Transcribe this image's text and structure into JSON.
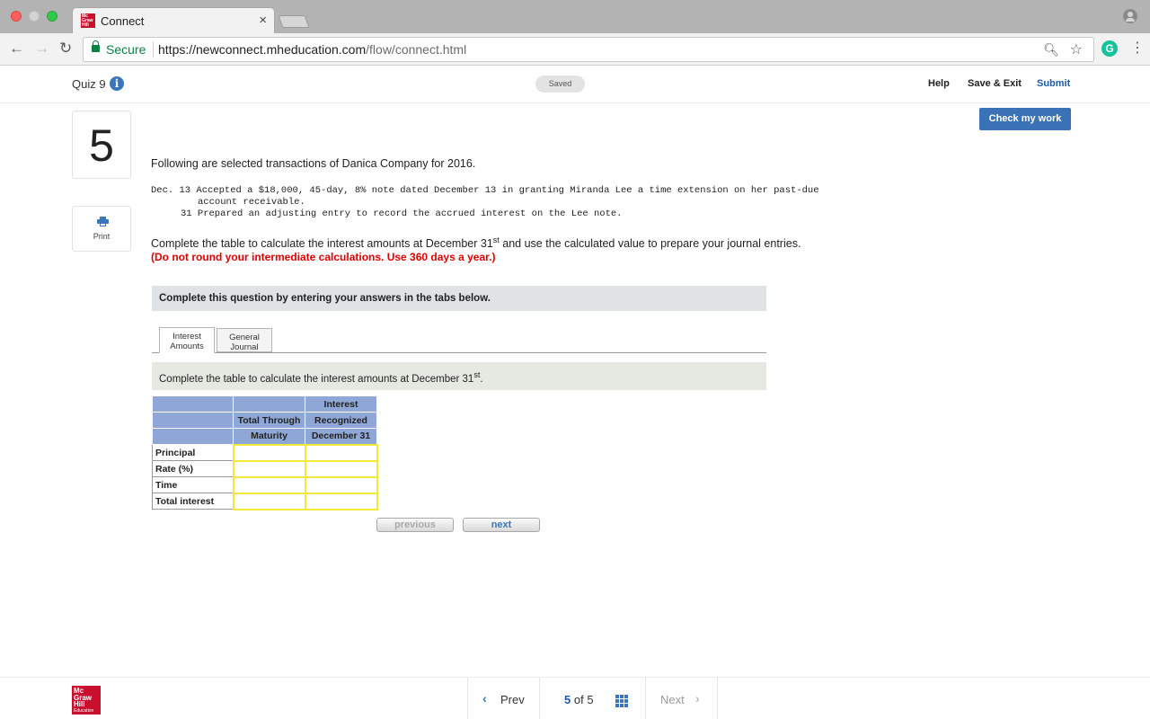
{
  "browser": {
    "tab_title": "Connect",
    "tab_close": "×",
    "secure_label": "Secure",
    "url_host": "https://newconnect.mheducation.com",
    "url_path": "/flow/connect.html"
  },
  "header": {
    "quiz_title": "Quiz 9",
    "info": "i",
    "saved": "Saved",
    "help": "Help",
    "save_exit": "Save & Exit",
    "submit": "Submit"
  },
  "question": {
    "number": "5",
    "print_label": "Print",
    "check_my_work": "Check my work",
    "intro": "Following are selected transactions of Danica Company for 2016.",
    "transactions": [
      "Dec. 13 Accepted a $18,000, 45-day, 8% note dated December 13 in granting Miranda Lee a time extension on her past-due",
      "account receivable.",
      "31 Prepared an adjusting entry to record the accrued interest on the Lee note."
    ],
    "instruction_before": "Complete the table to calculate the interest amounts at December 31",
    "instruction_sup": "st",
    "instruction_after": " and use the calculated value to prepare your journal entries.",
    "warning": "(Do not round your intermediate calculations. Use 360 days a year.)",
    "banner": "Complete this question by entering your answers in the tabs below.",
    "tabs": [
      {
        "line1": "Interest",
        "line2": "Amounts"
      },
      {
        "line1": "General",
        "line2": "Journal"
      }
    ],
    "sub_instruction_before": "Complete the table to calculate the interest amounts at December 31",
    "sub_instruction_sup": "st",
    "sub_instruction_after": "."
  },
  "table": {
    "col2_header": [
      "",
      "Total Through",
      "Maturity"
    ],
    "col3_header": [
      "Interest",
      "Recognized",
      "December 31"
    ],
    "rows": [
      "Principal",
      "Rate (%)",
      "Time",
      "Total interest"
    ]
  },
  "buttons": {
    "previous": "previous",
    "next": "next"
  },
  "footer": {
    "logo_line1": "Mc",
    "logo_line2": "Graw",
    "logo_line3": "Hill",
    "logo_line4": "Education",
    "prev": "Prev",
    "current_page": "5",
    "of": "of",
    "total_pages": "5",
    "next": "Next"
  }
}
